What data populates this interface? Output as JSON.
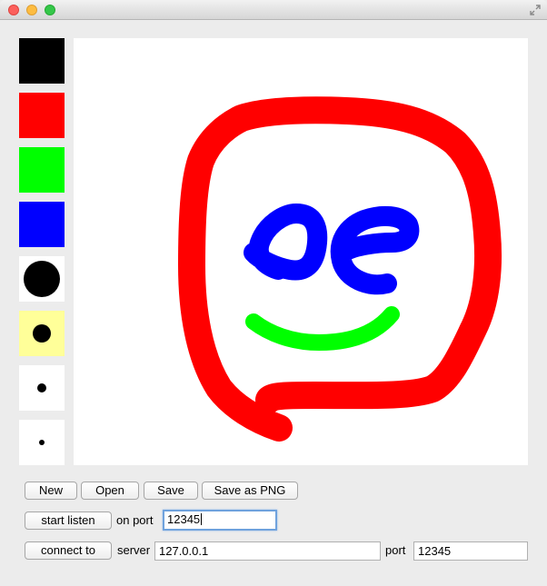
{
  "window": {
    "title": ""
  },
  "palette": {
    "colors": [
      {
        "name": "black",
        "hex": "#000000"
      },
      {
        "name": "red",
        "hex": "#ff0000"
      },
      {
        "name": "green",
        "hex": "#00ff00"
      },
      {
        "name": "blue",
        "hex": "#0000ff"
      }
    ],
    "brush_sizes": [
      "large",
      "medium",
      "small",
      "tiny"
    ],
    "selected_brush": "medium"
  },
  "canvas": {
    "background": "#ffffff",
    "drawing": "face: red outline, blue eyes, green smile"
  },
  "toolbar": {
    "new_label": "New",
    "open_label": "Open",
    "save_label": "Save",
    "save_png_label": "Save as PNG"
  },
  "listen": {
    "button_label": "start listen",
    "on_port_label": "on port",
    "port_value": "12345"
  },
  "connect": {
    "button_label": "connect to",
    "server_label": "server",
    "server_value": "127.0.0.1",
    "port_label": "port",
    "port_value": "12345"
  }
}
